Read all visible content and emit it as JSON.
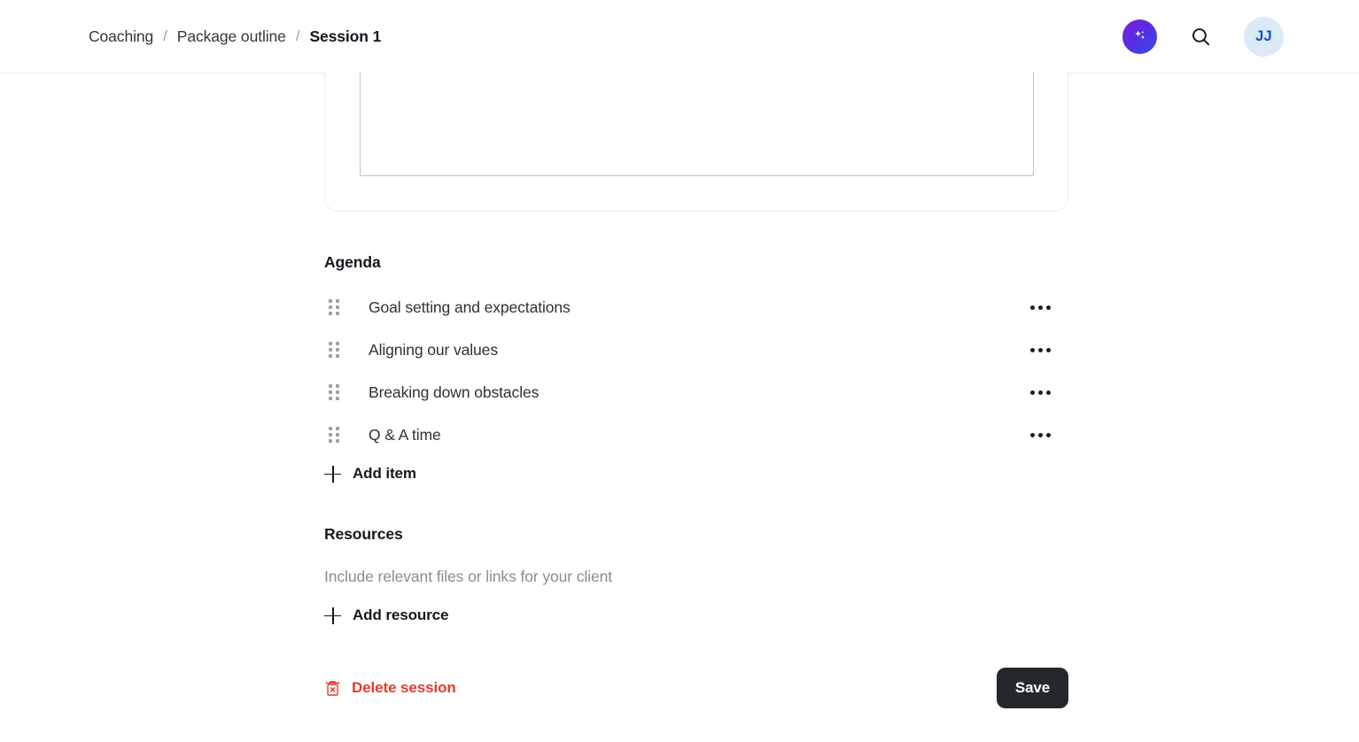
{
  "header": {
    "breadcrumb": {
      "items": [
        {
          "label": "Coaching",
          "current": false
        },
        {
          "label": "Package outline",
          "current": false
        },
        {
          "label": "Session 1",
          "current": true
        }
      ],
      "separator": "/"
    },
    "ai_button_name": "ai-sparkle-icon",
    "search_icon_name": "search-icon",
    "avatar_initials": "JJ",
    "avatar_bg": "#dceaf8",
    "avatar_text_color": "#1452c8",
    "ai_gradient_from": "#7b22d6",
    "ai_gradient_to": "#2f4ff0"
  },
  "notes": {
    "value": "",
    "placeholder": ""
  },
  "agenda": {
    "title": "Agenda",
    "items": [
      {
        "text": "Goal setting and expectations"
      },
      {
        "text": "Aligning our values"
      },
      {
        "text": "Breaking down obstacles"
      },
      {
        "text": "Q & A time"
      }
    ],
    "add_label": "Add item"
  },
  "resources": {
    "title": "Resources",
    "hint": "Include relevant files or links for your client",
    "add_label": "Add resource"
  },
  "footer": {
    "delete_label": "Delete session",
    "delete_color": "#e8392c",
    "save_label": "Save",
    "save_bg": "#24282c"
  }
}
